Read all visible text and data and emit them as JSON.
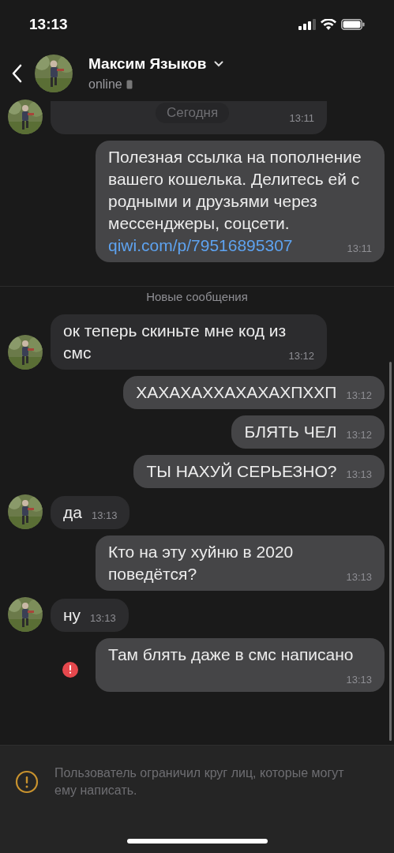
{
  "status_bar": {
    "time": "13:13"
  },
  "header": {
    "name": "Максим Языков",
    "status": "online"
  },
  "messages": [
    {
      "kind": "incoming",
      "time": "13:11",
      "date_chip": "Сегодня"
    },
    {
      "kind": "outgoing",
      "text": "Полезная ссылка на пополнение вашего кошелька. Делитесь ей с родными и друзьями через мессенджеры, соцсети.",
      "link": "qiwi.com/p/79516895307",
      "time": "13:11",
      "error": false
    },
    {
      "kind": "divider",
      "text": "Новые сообщения"
    },
    {
      "kind": "incoming",
      "text": "ок теперь скиньте мне код из смс",
      "time": "13:12"
    },
    {
      "kind": "outgoing",
      "text": "ХАХАХАХХАХАХАХПХХП",
      "time": "13:12",
      "error": false
    },
    {
      "kind": "outgoing",
      "text": "БЛЯТЬ ЧЕЛ",
      "time": "13:12",
      "error": false
    },
    {
      "kind": "outgoing",
      "text": "ТЫ НАХУЙ СЕРЬЕЗНО?",
      "time": "13:13",
      "error": false
    },
    {
      "kind": "incoming",
      "text": "да",
      "time": "13:13"
    },
    {
      "kind": "outgoing",
      "text": "Кто на эту хуйню в 2020 поведётся?",
      "time": "13:13",
      "error": false
    },
    {
      "kind": "incoming",
      "text": "ну",
      "time": "13:13"
    },
    {
      "kind": "outgoing",
      "text": "Там блять даже в смс написано",
      "time": "13:13",
      "error": true
    }
  ],
  "notice": {
    "text": "Пользователь ограничил круг лиц, которые могут ему написать."
  }
}
